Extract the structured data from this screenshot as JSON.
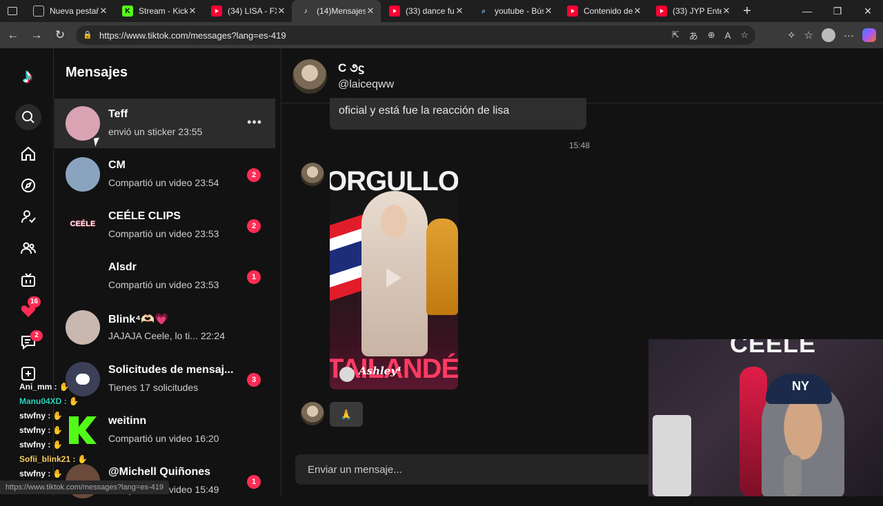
{
  "browser": {
    "tabs": [
      {
        "label": "Nueva pestaña",
        "favicon": "page-icon",
        "active": false
      },
      {
        "label": "Stream - Kick",
        "favicon": "kick-icon",
        "active": false
      },
      {
        "label": "(34) LISA - FXC",
        "favicon": "youtube-icon",
        "active": false
      },
      {
        "label": "(14)Mensajes",
        "favicon": "tiktok-icon",
        "active": true
      },
      {
        "label": "(33) dance futu",
        "favicon": "youtube-icon",
        "active": false
      },
      {
        "label": "youtube - Bús",
        "favicon": "search-icon",
        "active": false
      },
      {
        "label": "Contenido del",
        "favicon": "youtube-icon",
        "active": false
      },
      {
        "label": "(33) JYP Entert",
        "favicon": "youtube-icon",
        "active": false
      }
    ],
    "url": "https://www.tiktok.com/messages?lang=es-419",
    "status_url": "https://www.tiktok.com/messages?lang=es-419"
  },
  "rail": {
    "messages_badge": "2",
    "activity_badge": "16"
  },
  "list": {
    "title": "Mensajes",
    "conversations": [
      {
        "name": "Teff",
        "preview": "envió un sticker",
        "time": "23:55",
        "unread": "",
        "selected": true,
        "avatar_color": "#d9a3b3"
      },
      {
        "name": "CM",
        "preview": "Compartió un video",
        "time": "23:54",
        "unread": "2",
        "selected": false,
        "avatar_color": "#8aa4c0"
      },
      {
        "name": "CEÉLE CLIPS",
        "preview": "Compartió un video",
        "time": "23:53",
        "unread": "2",
        "selected": false,
        "avatar_color": "#121212"
      },
      {
        "name": "Alsdr",
        "preview": "Compartió un video",
        "time": "23:53",
        "unread": "1",
        "selected": false,
        "avatar_color": "#121212"
      },
      {
        "name": "Blink⁴🫶🏻💗",
        "preview": "JAJAJA Ceele, lo ti...",
        "time": "22:24",
        "unread": "",
        "selected": false,
        "avatar_color": "#c9b8b0"
      },
      {
        "name": "Solicitudes de mensaj...",
        "preview": "Tienes 17 solicitudes",
        "time": "",
        "unread": "3",
        "selected": false,
        "avatar_color": "#3c3f58"
      },
      {
        "name": "weitinn",
        "preview": "Compartió un video",
        "time": "16:20",
        "unread": "",
        "selected": false,
        "avatar_color": "#53fc18"
      },
      {
        "name": "@Michell Quiñones",
        "preview": "Compartió un video",
        "time": "15:49",
        "unread": "1",
        "selected": false,
        "avatar_color": "#6a4a3a"
      }
    ]
  },
  "chat": {
    "header_name": "C ૭ϛ",
    "header_username": "@laiceqww",
    "partial_message": "oficial y está fue la reacción de lisa",
    "time_divider": "15:48",
    "video": {
      "top_text": "ORGULLO",
      "bottom_text": "TAILANDÉS",
      "tag": "Ashley⁴"
    },
    "sticker": "🙏",
    "composer_placeholder": "Enviar un mensaje..."
  },
  "overlays": {
    "webcam_watermark": "CEÉLE",
    "cap_logo": "NY",
    "stream_chat": [
      {
        "user": "Ani_mm",
        "color": "#ffffff"
      },
      {
        "user": "Manu04XD",
        "color": "#2dd4bf"
      },
      {
        "user": "stwfny",
        "color": "#ffffff"
      },
      {
        "user": "stwfny",
        "color": "#ffffff"
      },
      {
        "user": "stwfny",
        "color": "#ffffff"
      },
      {
        "user": "Sofii_blink21",
        "color": "#ffd166"
      },
      {
        "user": "stwfny",
        "color": "#ffffff"
      }
    ]
  },
  "colors": {
    "accent": "#fe2c55",
    "background": "#121212",
    "selected_row": "#2c2c2c"
  }
}
